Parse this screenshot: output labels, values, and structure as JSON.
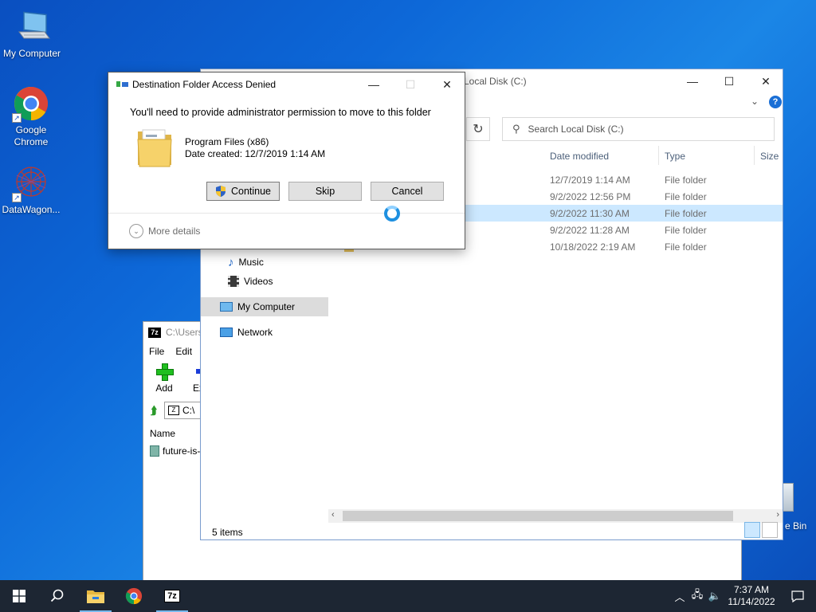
{
  "desktop": {
    "icons": [
      {
        "label": "My Computer"
      },
      {
        "label": "Google Chrome"
      },
      {
        "label": "DataWagon..."
      }
    ],
    "recycle_bin_partial": "e Bin"
  },
  "sevenzip": {
    "title": "C:\\Users",
    "logo": "7z",
    "menu": [
      "File",
      "Edit"
    ],
    "toolbar": {
      "add": "Add",
      "extract": "Extra"
    },
    "path": "C:\\",
    "column_name": "Name",
    "rows": [
      "future-is-"
    ]
  },
  "explorer": {
    "title": "Local Disk (C:)",
    "search_placeholder": "Search Local Disk (C:)",
    "columns": {
      "date": "Date modified",
      "type": "Type",
      "size": "Size"
    },
    "nav": {
      "music": "Music",
      "videos": "Videos",
      "my_computer": "My Computer",
      "network": "Network"
    },
    "files": [
      {
        "date": "12/7/2019 1:14 AM",
        "type": "File folder"
      },
      {
        "date": "9/2/2022 12:56 PM",
        "type": "File folder"
      },
      {
        "date": "9/2/2022 11:30 AM",
        "type": "File folder"
      },
      {
        "date": "9/2/2022 11:28 AM",
        "type": "File folder"
      },
      {
        "date": "10/18/2022 2:19 AM",
        "type": "File folder"
      }
    ],
    "status": "5 items"
  },
  "dialog": {
    "title": "Destination Folder Access Denied",
    "message": "You'll need to provide administrator permission to move to this folder",
    "folder_name": "Program Files (x86)",
    "folder_date": "Date created: 12/7/2019 1:14 AM",
    "buttons": {
      "continue": "Continue",
      "skip": "Skip",
      "cancel": "Cancel"
    },
    "more_details": "More details"
  },
  "taskbar": {
    "time": "7:37 AM",
    "date": "11/14/2022",
    "sevenzip_label": "7z"
  },
  "colors": {
    "accent": "#0078d7",
    "selection": "#cce8ff",
    "taskbar": "#1d2633"
  }
}
